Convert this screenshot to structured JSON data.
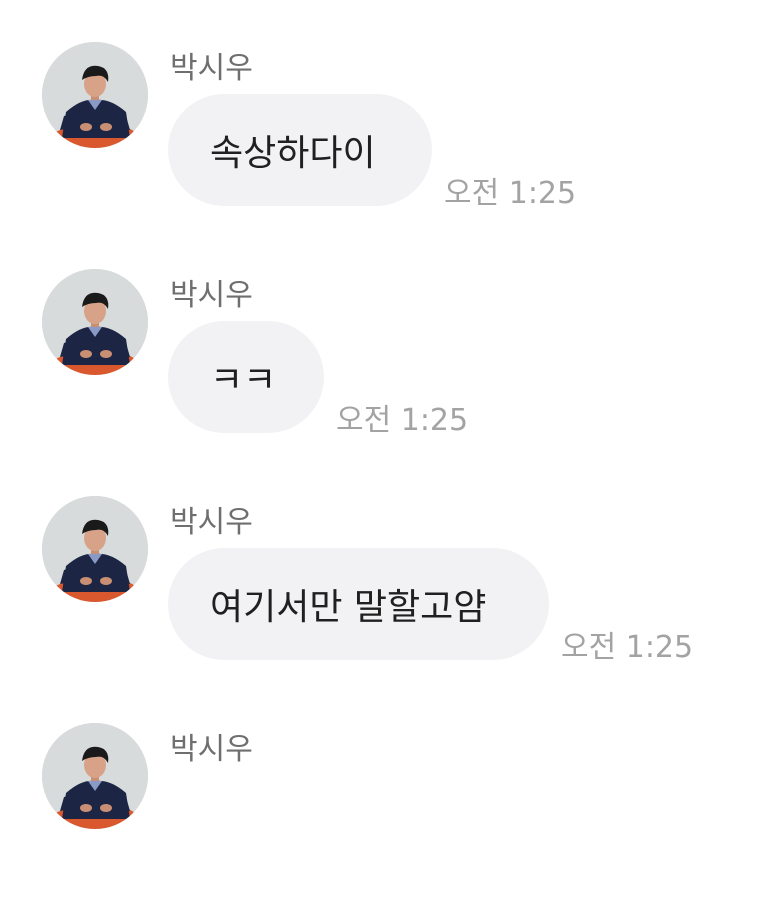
{
  "messages": [
    {
      "sender": "박시우",
      "text": "속상하다이",
      "time": "오전 1:25"
    },
    {
      "sender": "박시우",
      "text": "ㅋㅋ",
      "time": "오전 1:25"
    },
    {
      "sender": "박시우",
      "text": "여기서만 말할고얌",
      "time": "오전 1:25"
    },
    {
      "sender": "박시우"
    }
  ]
}
